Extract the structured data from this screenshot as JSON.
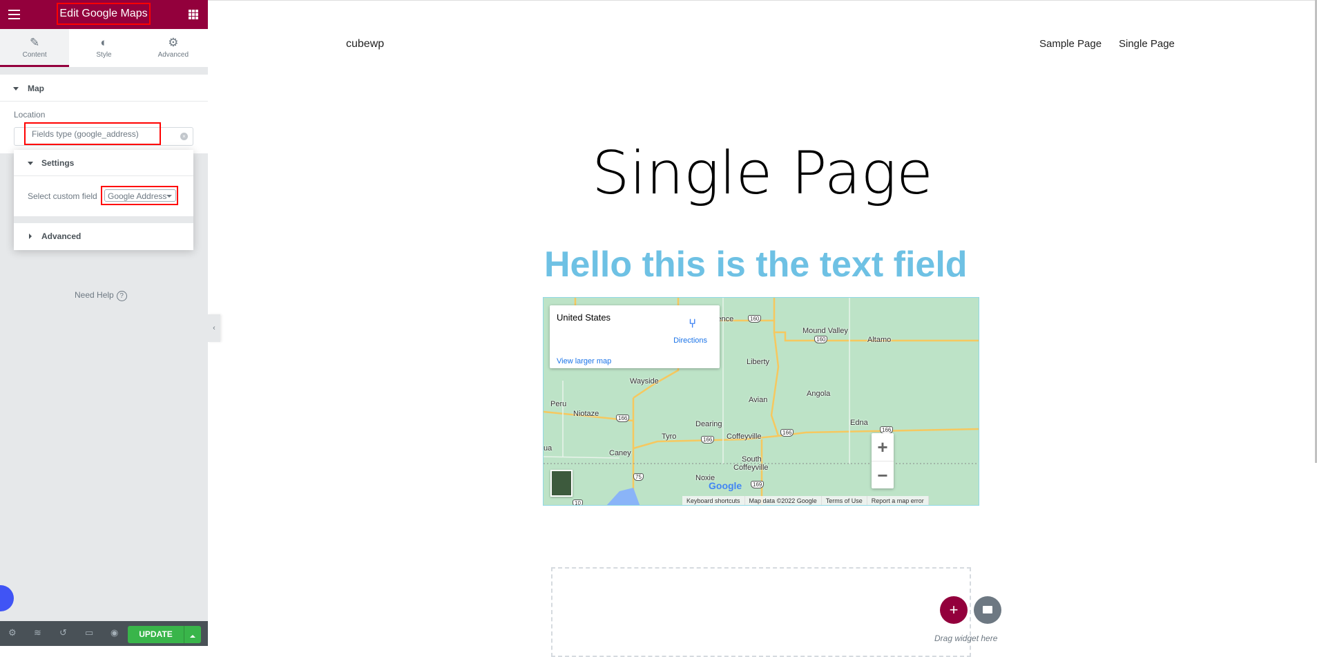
{
  "editor": {
    "title": "Edit Google Maps",
    "tabs": [
      {
        "label": "Content",
        "icon": "pencil-icon"
      },
      {
        "label": "Style",
        "icon": "contrast-icon"
      },
      {
        "label": "Advanced",
        "icon": "gear-icon"
      }
    ],
    "section": "Map",
    "location_label": "Location",
    "location_value": "Fields type (google_address)",
    "popup": {
      "title": "Settings",
      "field_label": "Select custom field",
      "field_value": "Google Address",
      "advanced": "Advanced"
    },
    "help": "Need Help",
    "update": "UPDATE",
    "accent": "#93003c",
    "update_color": "#39b54a"
  },
  "site": {
    "name": "cubewp",
    "nav": [
      "Sample Page",
      "Single Page"
    ],
    "title": "Single Page",
    "text_field": "Hello this is the text field",
    "text_color": "#6ec1e4"
  },
  "map": {
    "place": "United States",
    "directions": "Directions",
    "larger": "View larger map",
    "labels": [
      "endence",
      "Mound Valley",
      "Altamo",
      "Liberty",
      "Wayside",
      "Angola",
      "Avian",
      "Peru",
      "Niotaze",
      "Dearing",
      "Edna",
      "Tyro",
      "Coffeyville",
      "Caney",
      "South",
      "Coffeyville",
      "Noxie",
      "ua"
    ],
    "shields": [
      "160",
      "160",
      "166",
      "166",
      "166",
      "166",
      "75",
      "169",
      "10"
    ],
    "logo": "Google",
    "footer": [
      "Keyboard shortcuts",
      "Map data ©2022 Google",
      "Terms of Use",
      "Report a map error"
    ],
    "zoom_in": "+",
    "zoom_out": "−"
  },
  "drop": {
    "add": "+",
    "text": "Drag widget here"
  }
}
